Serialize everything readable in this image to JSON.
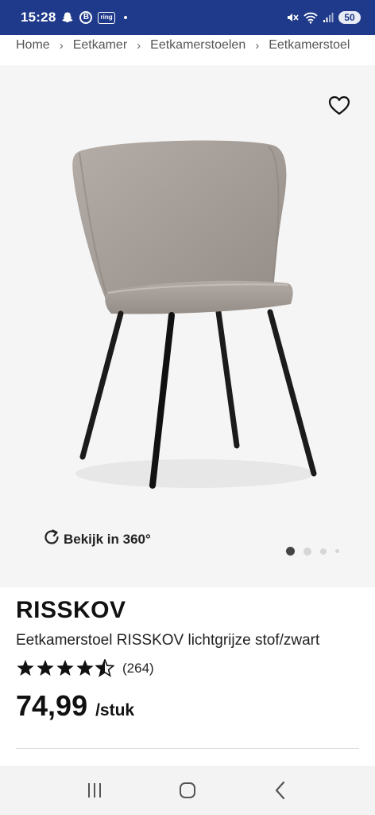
{
  "status_bar": {
    "time": "15:28",
    "icons": [
      "snapchat-icon",
      "b-badge-icon",
      "ring-icon",
      "notification-dot-icon",
      "mute-icon",
      "wifi-icon",
      "signal-icon",
      "battery-icon"
    ],
    "b_badge": "B",
    "ring_badge": "ring",
    "battery_level": "50"
  },
  "breadcrumb": {
    "items": [
      "Home",
      "Eetkamer",
      "Eetkamerstoelen",
      "Eetkamerstoel"
    ],
    "separator": "›"
  },
  "gallery": {
    "favorite_icon": "heart-outline-icon",
    "rotate_icon": "rotate-360-icon",
    "view_360_label": "Bekijk in 360°",
    "dots_count": 4,
    "active_index": 0
  },
  "product": {
    "brand": "RISSKOV",
    "title": "Eetkamerstoel RISSKOV lichtgrijze stof/zwart",
    "rating_value": 4.5,
    "rating_max": 5,
    "rating_count": "(264)",
    "price": "74,99",
    "price_unit": "/stuk"
  },
  "nav_bar": {
    "buttons": [
      "recent-apps-icon",
      "home-icon",
      "back-icon"
    ]
  },
  "colors": {
    "status_bar_bg": "#1f3a8a",
    "gallery_bg": "#f5f5f5",
    "star": "#111111",
    "text": "#111111"
  }
}
